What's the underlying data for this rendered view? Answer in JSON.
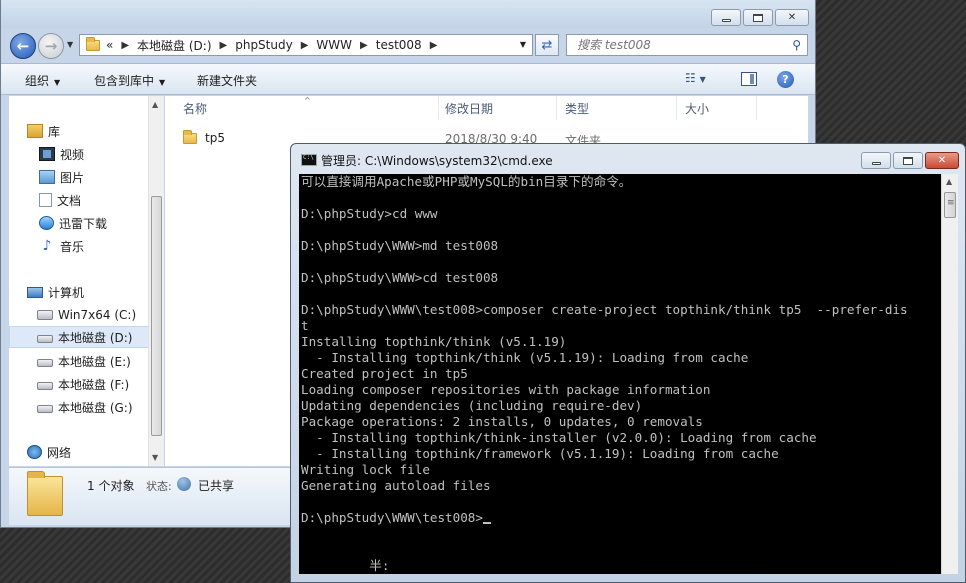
{
  "explorer": {
    "address": {
      "overflow_label": "«",
      "crumbs": [
        "本地磁盘 (D:)",
        "phpStudy",
        "WWW",
        "test008"
      ]
    },
    "search": {
      "placeholder": "搜索 test008"
    },
    "toolbar": {
      "organize": "组织",
      "include_in_library": "包含到库中",
      "new_folder": "新建文件夹"
    },
    "nav": {
      "libraries": "库",
      "videos": "视频",
      "pictures": "图片",
      "documents": "文档",
      "xunlei": "迅雷下载",
      "music": "音乐",
      "computer": "计算机",
      "drive_c": "Win7x64 (C:)",
      "drive_d": "本地磁盘 (D:)",
      "drive_e": "本地磁盘 (E:)",
      "drive_f": "本地磁盘 (F:)",
      "drive_g": "本地磁盘 (G:)",
      "network": "网络"
    },
    "columns": [
      "名称",
      "修改日期",
      "类型",
      "大小"
    ],
    "files": [
      {
        "name": "tp5",
        "modified": "2018/8/30 9:40",
        "type": "文件夹"
      }
    ],
    "details": {
      "count": "1 个对象",
      "state_label": "状态:",
      "state_value": "已共享"
    }
  },
  "cmd": {
    "title": "管理员: C:\\Windows\\system32\\cmd.exe",
    "lines": [
      "可以直接调用Apache或PHP或MySQL的bin目录下的命令。",
      "",
      "D:\\phpStudy>cd www",
      "",
      "D:\\phpStudy\\WWW>md test008",
      "",
      "D:\\phpStudy\\WWW>cd test008",
      "",
      "D:\\phpStudy\\WWW\\test008>composer create-project topthink/think tp5  --prefer-dis",
      "t",
      "Installing topthink/think (v5.1.19)",
      "  - Installing topthink/think (v5.1.19): Loading from cache",
      "Created project in tp5",
      "Loading composer repositories with package information",
      "Updating dependencies (including require-dev)",
      "Package operations: 2 installs, 0 updates, 0 removals",
      "  - Installing topthink/think-installer (v2.0.0): Loading from cache",
      "  - Installing topthink/framework (v5.1.19): Loading from cache",
      "Writing lock file",
      "Generating autoload files",
      "",
      "D:\\phpStudy\\WWW\\test008>",
      "",
      "",
      "         半:"
    ]
  }
}
